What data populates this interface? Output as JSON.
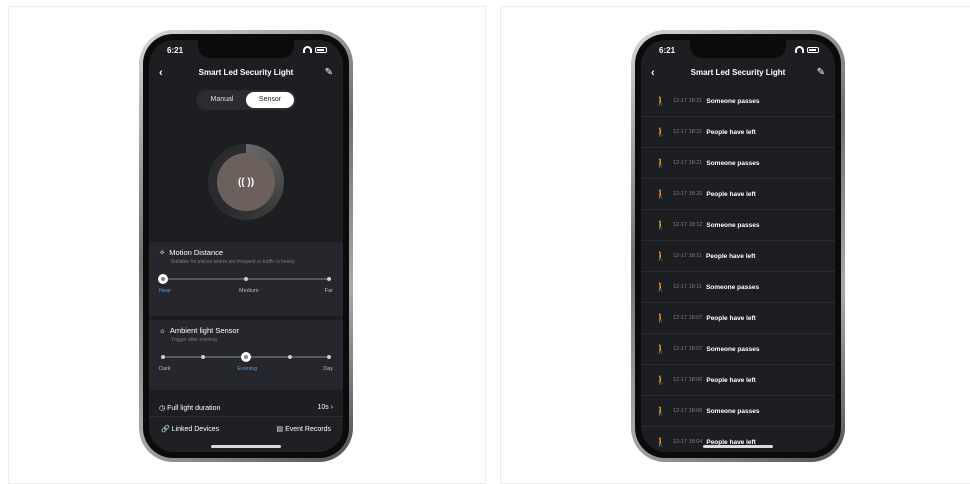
{
  "left_phone": {
    "status_time": "6:21",
    "title": "Smart Led Security Light",
    "tabs": [
      "Manual",
      "Sensor"
    ],
    "active_tab": "Sensor",
    "center_icon": "(( ))",
    "motion": {
      "title": "Motion Distance",
      "subtitle": "Suitable for places where are frequent or traffic is heavy",
      "labels": [
        "Near",
        "Medium",
        "Far"
      ],
      "selected": "Near",
      "level": 0
    },
    "ambient": {
      "title": "Ambient light Sensor",
      "subtitle": "Trigger after evening",
      "labels": [
        "Dark",
        "Evening",
        "Day"
      ],
      "selected": "Evening",
      "level": 0.5
    },
    "full_light": {
      "label": "Full light duration",
      "value": "10s"
    },
    "bottom": {
      "linked": "Linked Devices",
      "records": "Event Records"
    }
  },
  "right_phone": {
    "status_time": "6:21",
    "title": "Smart Led Security Light",
    "events": [
      {
        "time": "12-17 18:21",
        "text": "Someone passes"
      },
      {
        "time": "12-17 18:21",
        "text": "People have left"
      },
      {
        "time": "12-17 18:21",
        "text": "Someone passes"
      },
      {
        "time": "12-17 18:20",
        "text": "People have left"
      },
      {
        "time": "12-17 18:12",
        "text": "Someone passes"
      },
      {
        "time": "12-17 18:11",
        "text": "People have left"
      },
      {
        "time": "12-17 18:11",
        "text": "Someone passes"
      },
      {
        "time": "12-17 18:07",
        "text": "People have left"
      },
      {
        "time": "12-17 18:07",
        "text": "Someone passes"
      },
      {
        "time": "12-17 18:06",
        "text": "People have left"
      },
      {
        "time": "12-17 18:06",
        "text": "Someone passes"
      },
      {
        "time": "12-17 18:04",
        "text": "People have left"
      }
    ]
  }
}
